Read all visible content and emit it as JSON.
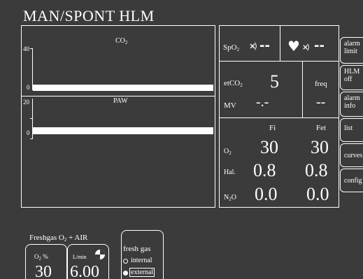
{
  "header": {
    "title": "MAN/SPONT  HLM"
  },
  "waveforms": {
    "co2": {
      "label": "CO",
      "label_sub": "2",
      "scale_max": "40",
      "scale_min": "0"
    },
    "paw": {
      "label": "PAW",
      "scale_max": "20",
      "scale_min": "0"
    }
  },
  "vitals": {
    "spo2": {
      "label": "SpO",
      "label_sub": "2",
      "muted_icon": "alarm-muted-icon",
      "value": "--"
    },
    "hr": {
      "icon": "heart-icon",
      "muted_icon": "alarm-muted-icon",
      "value": "--"
    },
    "etco2": {
      "label": "etCO",
      "label_sub": "2",
      "value": "5"
    },
    "freq": {
      "label": "freq",
      "value": "--"
    },
    "mv": {
      "label": "MV",
      "value": "-.-"
    }
  },
  "gas_table": {
    "col_fi": "Fi",
    "col_fet": "Fet",
    "rows": [
      {
        "label": "O",
        "label_sub": "2",
        "fi": "30",
        "fet": "30"
      },
      {
        "label": "Hal.",
        "label_sub": "",
        "fi": "0.8",
        "fet": "0.8"
      },
      {
        "label": "N",
        "label_sub": "2",
        "label_tail": "O",
        "fi": "0.0",
        "fet": "0.0"
      }
    ]
  },
  "side_menu": {
    "alarm_limit": "alarm limit",
    "hlm_off": "HLM off",
    "alarm_info": "alarm info",
    "list": "list",
    "curves": "curves",
    "config": "config"
  },
  "freshgas": {
    "title": "Freshgas O",
    "title_sub": "2",
    "title_tail": " + AIR",
    "o2_label": "O",
    "o2_sub": "2",
    "o2_unit": " %",
    "o2_value": "30",
    "flow_unit": "L/min",
    "flow_icon": "flow-dial-icon",
    "flow_value": "6.00"
  },
  "freshgas_source": {
    "title": "fresh gas",
    "options": [
      {
        "label": "internal",
        "selected": false
      },
      {
        "label": "external",
        "selected": true
      }
    ]
  }
}
